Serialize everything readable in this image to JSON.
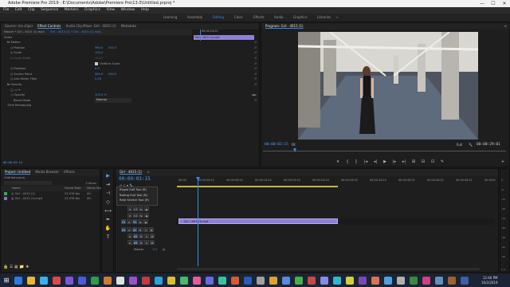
{
  "window": {
    "title": "Adobe Premiere Pro 2019 - E:\\Documents\\Adobe\\Premiere Pro\\13.0\\Untitled.prproj *",
    "min_glyph": "—",
    "max_glyph": "☐",
    "close_glyph": "✕"
  },
  "menu": [
    "File",
    "Edit",
    "Clip",
    "Sequence",
    "Markers",
    "Graphics",
    "View",
    "Window",
    "Help"
  ],
  "workspaces": {
    "items": [
      "Learning",
      "Assembly",
      "Editing",
      "Color",
      "Effects",
      "Audio",
      "Graphics",
      "Libraries"
    ],
    "active": "Editing",
    "more": "»"
  },
  "effect_controls": {
    "tabs": [
      "Source: (no clips)",
      "Effect Controls",
      "Audio Clip Mixer: Girl - 4015 (1)",
      "Metadata"
    ],
    "active_tab": "Effect Controls",
    "source_line": "Master * Girl - 4015 (1).mp4",
    "clip_line": "Girl - 4015 (1) * Girl - 4015 (1).mp4",
    "mini_timecode": "00:00:14:22",
    "mini_clip": "Girl - 4015 (1).mp4",
    "section_video": "Video",
    "motion": "Motion",
    "position_label": "Position",
    "position_x": "960.0",
    "position_y": "540.0",
    "scale_label": "Scale",
    "scale_value": "100.0",
    "scale_width_label": "Scale Width",
    "scale_width_value": "100.0",
    "uniform_scale": "Uniform Scale",
    "rotation_label": "Rotation",
    "rotation_value": "0.0",
    "anchor_label": "Anchor Point",
    "anchor_x": "960.0",
    "anchor_y": "540.0",
    "antiflicker_label": "Anti-flicker Filter",
    "antiflicker_value": "0.00",
    "opacity": "Opacity",
    "opacity_label": "Opacity",
    "opacity_value": "100.0 %",
    "blend_label": "Blend Mode",
    "blend_value": "Normal",
    "time_remap": "Time Remapping",
    "bottom_timecode": "00:00:03:15"
  },
  "program": {
    "title": "Program: Girl - 4015 (1)",
    "menu_glyph": "≡",
    "timecode": "00:00:03:15",
    "fit": "Fit",
    "quality": "Full",
    "duration": "00:00:29:01",
    "controls": [
      "▾",
      "{",
      "}",
      "|◂",
      "◂|",
      "▶",
      "|▸",
      "▸|",
      "⊞",
      "⊟",
      "⊡",
      "✎"
    ],
    "plus": "+"
  },
  "project": {
    "tabs": [
      "Project: Untitled",
      "Media Browser",
      "Effects"
    ],
    "active_tab": "Project: Untitled",
    "file_name": "Untitled.prproj",
    "item_count": "2 Items",
    "col_name": "Name",
    "col_rate": "Frame Rate",
    "col_start": "Media Start",
    "rows": [
      {
        "name": "Girl - 4015 (1)",
        "rate": "23.976 fps",
        "start": "00:",
        "color": "#2fb24a"
      },
      {
        "name": "Girl - 4015 (1).mp4",
        "rate": "23.976 fps",
        "start": "00:",
        "color": "#8a6fd8"
      }
    ]
  },
  "tools": {
    "items": [
      "selection-tool",
      "track-select-tool",
      "ripple-edit-tool",
      "razor-tool",
      "slip-tool",
      "pen-tool",
      "hand-tool",
      "type-tool"
    ],
    "glyphs": [
      "▶",
      "⇥",
      "⊣",
      "◇",
      "⟷",
      "✒",
      "✋",
      "T"
    ]
  },
  "timeline": {
    "tab": "Girl - 4015 (1)",
    "close_glyph": "×",
    "timecode": "00:00:03:15",
    "ruler": [
      "00:00",
      "00:00:04:23",
      "00:00:09:23",
      "00:00:14:23",
      "00:00:19:23",
      "00:00:24:23",
      "00:00:29:23",
      "00:00:34:23",
      "00:00:39:22",
      "00:00:44:22",
      "00:00:49:22",
      "00:00:54:22"
    ],
    "popup_items": [
      "Ripple Edit Tool (B)",
      "Rolling Edit Tool (N)",
      "Rate Stretch Tool (R)"
    ],
    "video_tracks": [
      "V3",
      "V2",
      "V1"
    ],
    "audio_tracks": [
      "A1",
      "A2",
      "A3"
    ],
    "track_btn_lock": "⊘",
    "track_btn_eye": "◉",
    "track_btn_m": "M",
    "track_btn_s": "S",
    "track_btn_mic": "⌘",
    "master_label": "Master",
    "master_value": "0.0",
    "clip_name": "Girl - 4015 (1).mp4",
    "meter_labels": [
      "0",
      "-6",
      "-12",
      "-18",
      "-24",
      "-30",
      "-36",
      "-42",
      "-48",
      "-54"
    ],
    "meter_s": "S S"
  },
  "taskbar": {
    "time": "12:46 PM",
    "date": "10/2/2019",
    "icon_colors": [
      "#2d7be0",
      "#e8b830",
      "#3bb0e8",
      "#e04848",
      "#7a56d8",
      "#4a5ad8",
      "#2c9c4c",
      "#d07a30",
      "#e0e0e0",
      "#9a50c8",
      "#c83a3a",
      "#30a0d8",
      "#d8c030",
      "#4ab86a",
      "#e85a90",
      "#6a6ae0",
      "#3bc0a0",
      "#d85a30",
      "#2a5ab8",
      "#a0a0a0",
      "#e0a030",
      "#5a8ad8",
      "#48b048",
      "#c84848",
      "#8a8ae0",
      "#30b8c8",
      "#d0d040",
      "#7a4ab0",
      "#e07050",
      "#50a0e0",
      "#b0b0b0",
      "#3a8a3a",
      "#d04080",
      "#6090c0",
      "#a06030",
      "#4060a0"
    ]
  }
}
